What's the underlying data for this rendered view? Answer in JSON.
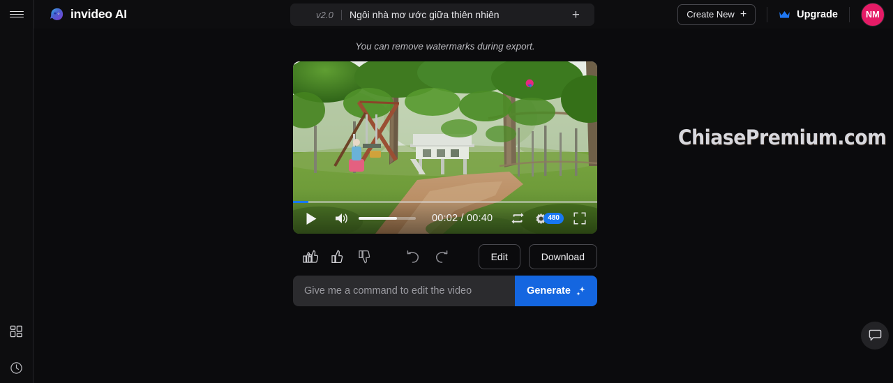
{
  "header": {
    "menu_icon": "hamburger-menu-icon",
    "brand_logo_icon": "invideo-logo-icon",
    "brand_name": "invideo AI",
    "project": {
      "version": "v2.0",
      "title": "Ngôi nhà mơ ước giữa thiên nhiên",
      "add_icon": "+"
    },
    "create_new_label": "Create New",
    "create_new_plus": "+",
    "upgrade_label": "Upgrade",
    "crown_icon": "crown-icon",
    "avatar_initials": "NM",
    "avatar_color": "#e51b66"
  },
  "sidebar": {
    "items": [
      {
        "name": "dashboard",
        "icon": "grid-dashboard-icon"
      },
      {
        "name": "history",
        "icon": "clock-history-icon"
      }
    ]
  },
  "main": {
    "watermark_note": "You can remove watermarks during export.",
    "page_watermark": "ChiasePremium.com",
    "video": {
      "play_icon": "play-icon",
      "volume_icon": "volume-on-icon",
      "volume_level": 67,
      "current_time": "00:02",
      "total_time": "00:40",
      "time_display": "00:02 / 00:40",
      "progress_percent": 5,
      "loop_icon": "loop-icon",
      "settings_icon": "gear-icon",
      "quality_badge": "480",
      "fullscreen_icon": "fullscreen-icon",
      "scene_watermark_icon": "invideo-watermark-icon"
    },
    "actions": {
      "love_icon": "double-thumbs-up-icon",
      "like_icon": "thumbs-up-icon",
      "dislike_icon": "thumbs-down-icon",
      "undo_icon": "undo-arrow-icon",
      "redo_icon": "redo-arrow-icon",
      "edit_label": "Edit",
      "download_label": "Download"
    },
    "command": {
      "value": "",
      "placeholder": "Give me a command to edit the video",
      "generate_label": "Generate",
      "sparkle_icon": "sparkle-icon"
    }
  },
  "chat": {
    "icon": "chat-bubble-icon"
  },
  "colors": {
    "accent_blue": "#1466e0",
    "player_blue": "#1877f2",
    "avatar_pink": "#e51b66",
    "background": "#0b0b0d"
  }
}
